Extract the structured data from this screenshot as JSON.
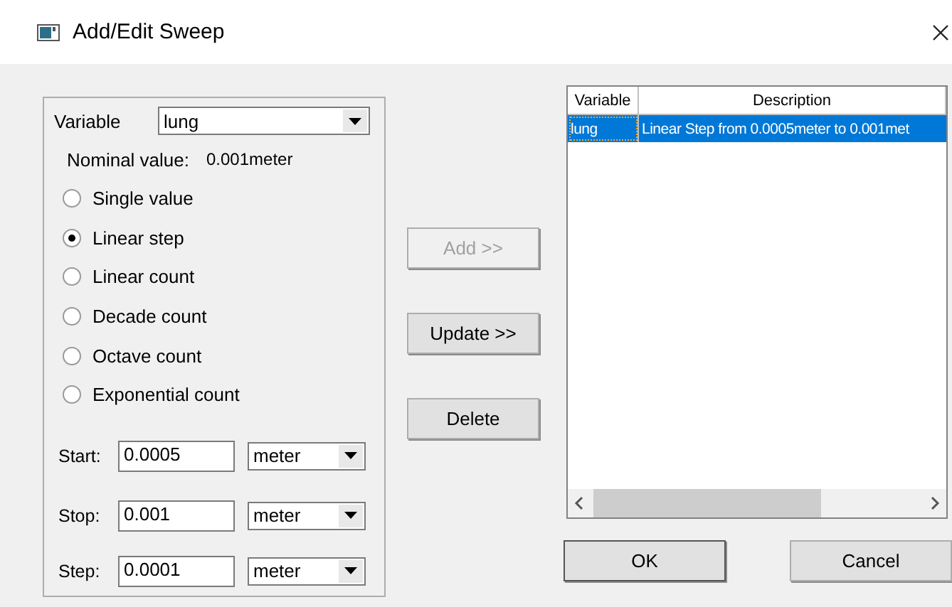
{
  "window": {
    "title": "Add/Edit Sweep"
  },
  "variable": {
    "label": "Variable",
    "value": "lung"
  },
  "nominal": {
    "label": "Nominal value:",
    "value": "0.001meter"
  },
  "modes": [
    {
      "label": "Single value",
      "selected": false
    },
    {
      "label": "Linear step",
      "selected": true
    },
    {
      "label": "Linear count",
      "selected": false
    },
    {
      "label": "Decade count",
      "selected": false
    },
    {
      "label": "Octave count",
      "selected": false
    },
    {
      "label": "Exponential count",
      "selected": false
    }
  ],
  "ranges": [
    {
      "label": "Start:",
      "value": "0.0005",
      "unit": "meter"
    },
    {
      "label": "Stop:",
      "value": "0.001",
      "unit": "meter"
    },
    {
      "label": "Step:",
      "value": "0.0001",
      "unit": "meter"
    }
  ],
  "actions": [
    {
      "label": "Add >>",
      "disabled": true
    },
    {
      "label": "Update >>",
      "disabled": false
    },
    {
      "label": "Delete",
      "disabled": false
    }
  ],
  "table": {
    "columns": [
      "Variable",
      "Description"
    ],
    "rows": [
      {
        "cells": [
          "lung",
          "Linear Step from 0.0005meter to 0.001met"
        ],
        "selected": true
      }
    ]
  },
  "buttons": [
    "OK",
    "Cancel"
  ]
}
